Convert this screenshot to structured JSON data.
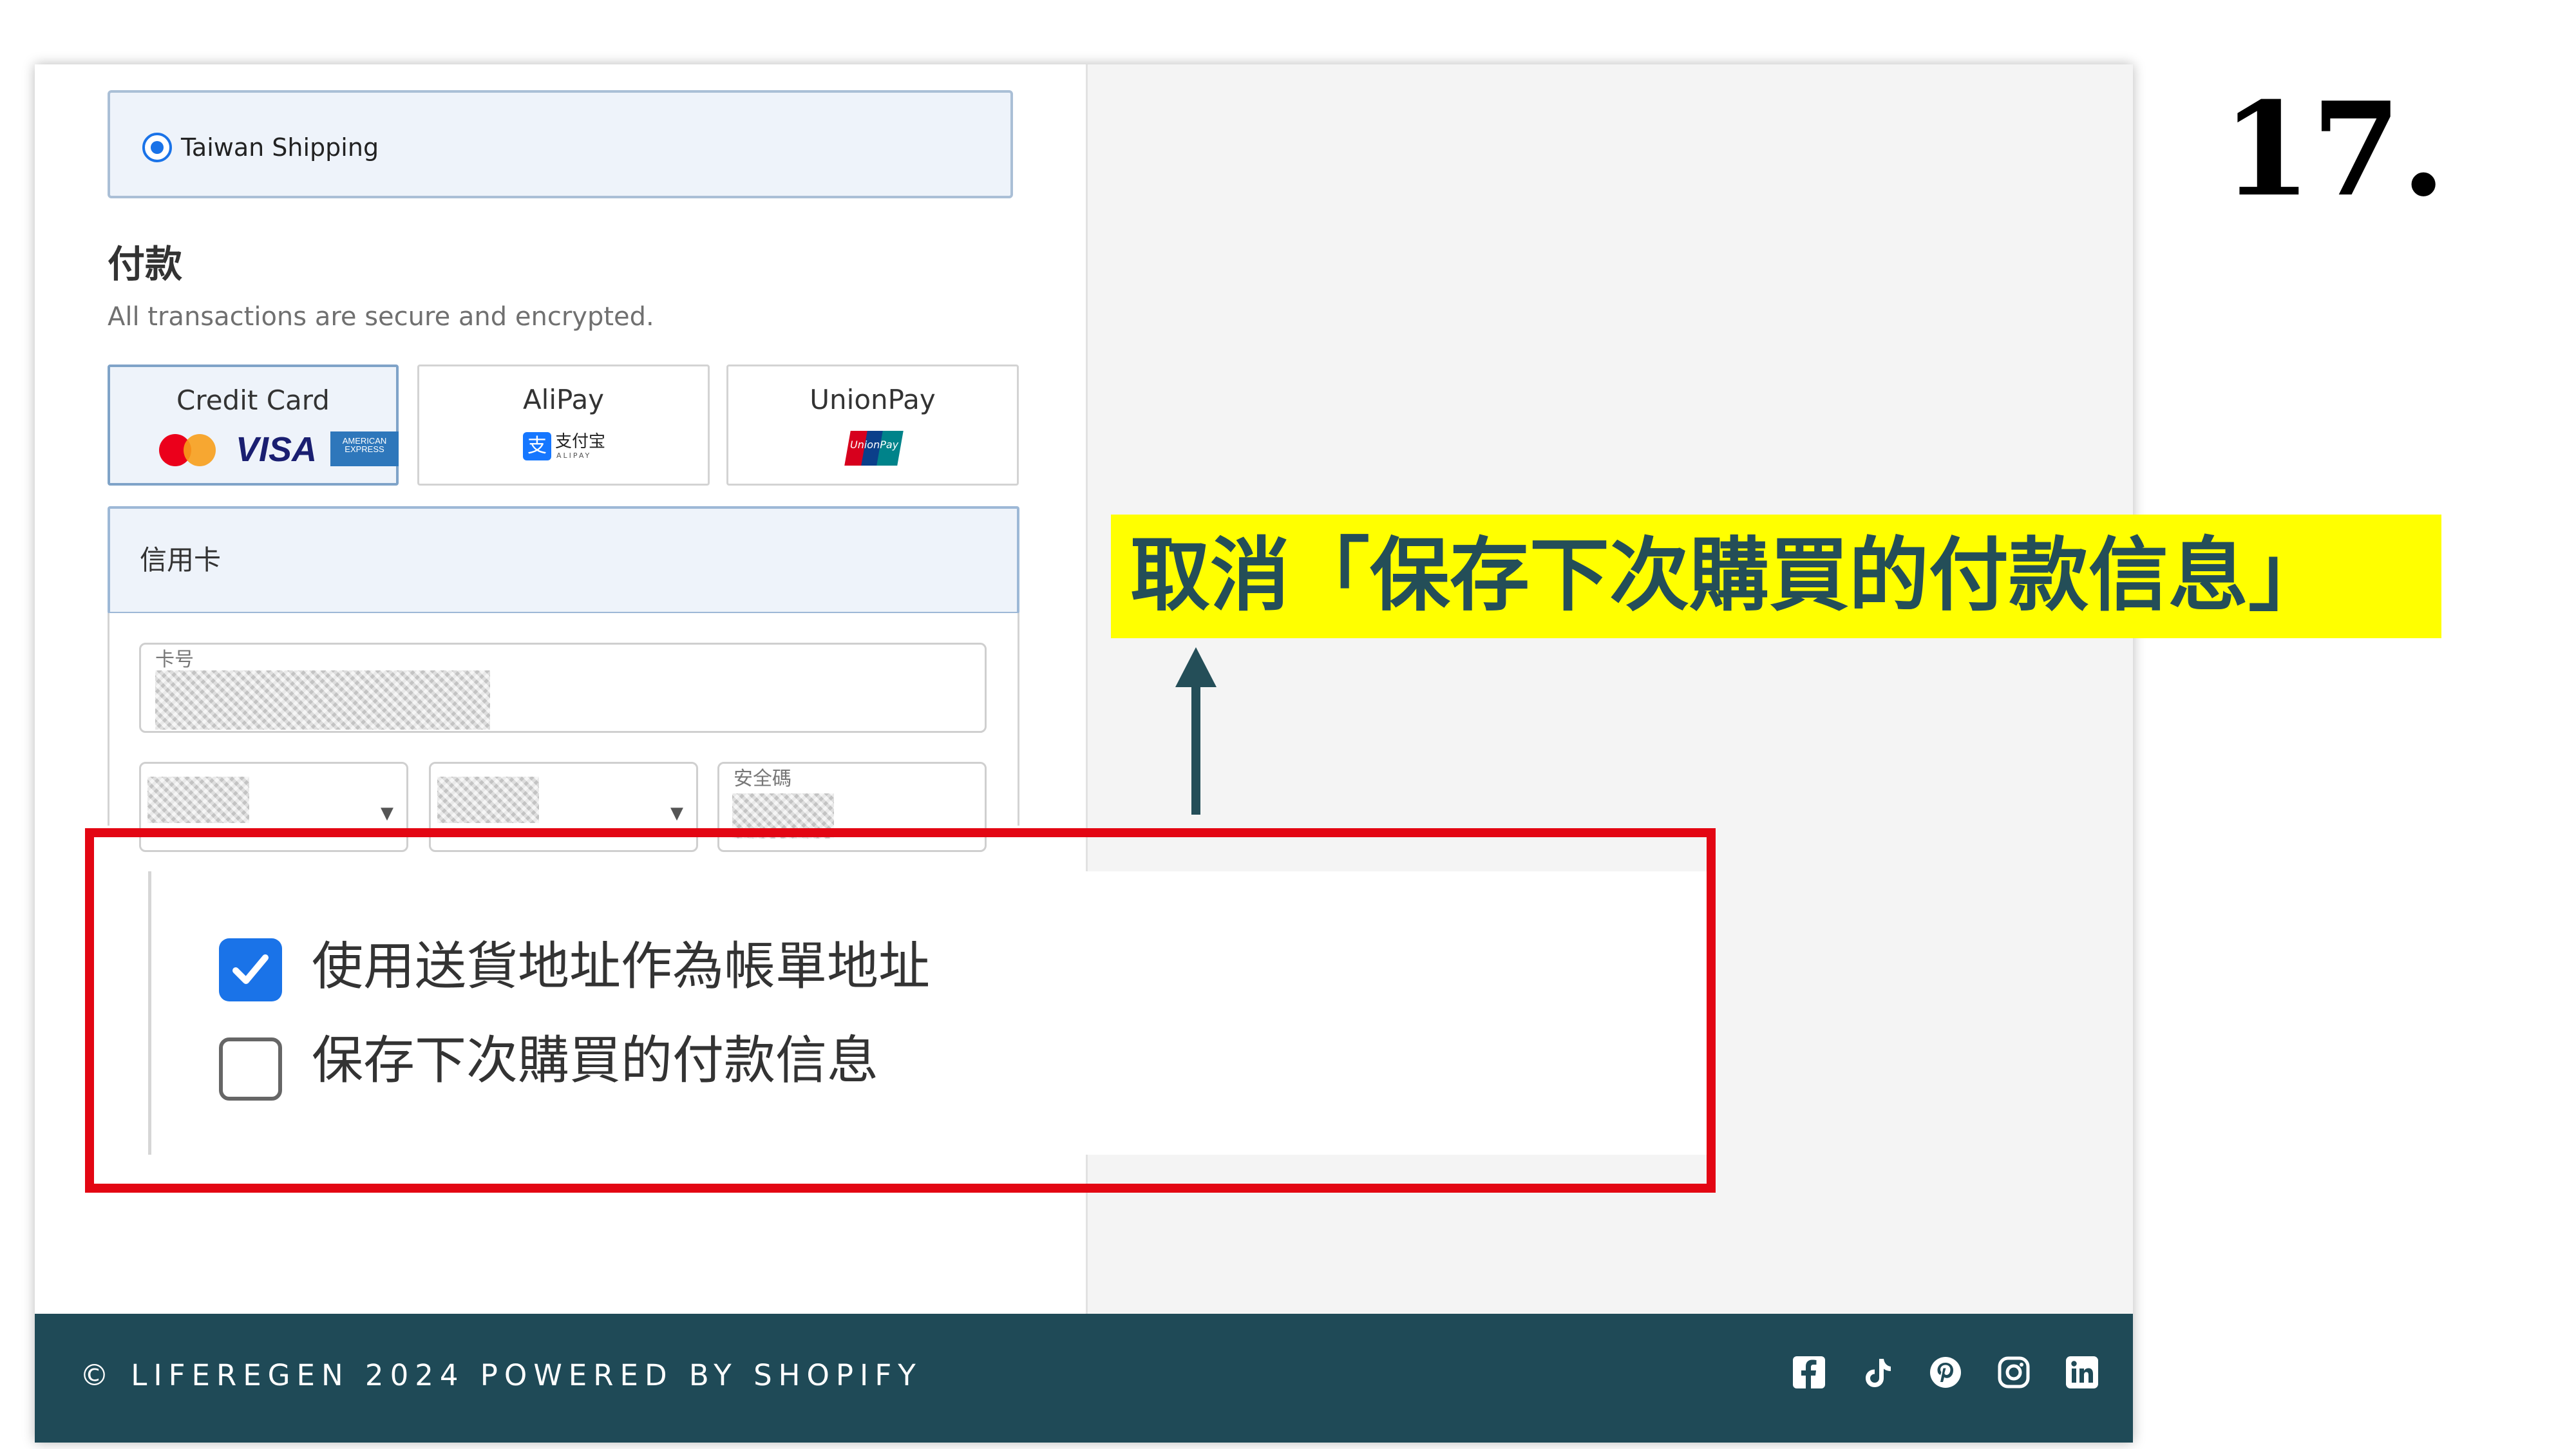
{
  "shipping": {
    "option_label": "Taiwan Shipping",
    "selected": true
  },
  "payment": {
    "title": "付款",
    "subtitle": "All transactions are secure and encrypted.",
    "methods": [
      {
        "label": "Credit Card",
        "icons": [
          "mastercard-logo",
          "visa-logo",
          "amex-logo"
        ],
        "selected": true
      },
      {
        "label": "AliPay",
        "icons": [
          "alipay-logo"
        ],
        "selected": false
      },
      {
        "label": "UnionPay",
        "icons": [
          "unionpay-logo"
        ],
        "selected": false
      }
    ],
    "logo_text": {
      "visa": "VISA",
      "amex": "AMERICAN EXPRESS",
      "alipay_mark": "支",
      "alipay_name": "支付宝",
      "alipay_sub": "ALIPAY",
      "unionpay": "UnionPay"
    },
    "credit_card": {
      "section_title": "信用卡",
      "card_number_label": "卡号",
      "cvv_label": "安全碼"
    }
  },
  "checkboxes": [
    {
      "label": "使用送貨地址作為帳單地址",
      "checked": true
    },
    {
      "label": "保存下次購買的付款信息",
      "checked": false
    }
  ],
  "footer": {
    "copyright": "© LIFEREGEN 2024 POWERED BY SHOPIFY",
    "social_icons": [
      "facebook-icon",
      "tiktok-icon",
      "pinterest-icon",
      "instagram-icon",
      "linkedin-icon"
    ]
  },
  "annotation": {
    "instruction": "取消「保存下次購買的付款信息」",
    "step": "17."
  },
  "colors": {
    "accent_blue": "#1a73e8",
    "footer_bg": "#1f4a57",
    "highlight_red": "#e30613",
    "banner_yellow": "#ffff00",
    "arrow": "#244e58"
  }
}
